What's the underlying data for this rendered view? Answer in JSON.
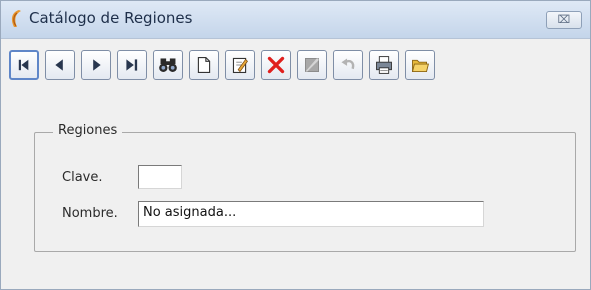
{
  "window": {
    "title": "Catálogo de Regiones",
    "close_glyph": "⌧"
  },
  "toolbar": {
    "buttons": [
      {
        "name": "first-record-button",
        "icon": "first-record-icon"
      },
      {
        "name": "previous-record-button",
        "icon": "previous-record-icon"
      },
      {
        "name": "next-record-button",
        "icon": "next-record-icon"
      },
      {
        "name": "last-record-button",
        "icon": "last-record-icon"
      },
      {
        "name": "search-button",
        "icon": "binoculars-icon"
      },
      {
        "name": "new-button",
        "icon": "new-document-icon"
      },
      {
        "name": "edit-button",
        "icon": "edit-icon"
      },
      {
        "name": "delete-button",
        "icon": "delete-icon"
      },
      {
        "name": "save-button",
        "icon": "save-icon"
      },
      {
        "name": "undo-button",
        "icon": "undo-icon"
      },
      {
        "name": "print-button",
        "icon": "printer-icon"
      },
      {
        "name": "open-button",
        "icon": "folder-icon"
      }
    ]
  },
  "form": {
    "group_title": "Regiones",
    "clave_label": "Clave.",
    "clave_value": "",
    "nombre_label": "Nombre.",
    "nombre_value": "No asignada..."
  },
  "colors": {
    "delete_red": "#e0201e",
    "nav_dark": "#28364e",
    "accent_blue": "#5f86c8"
  }
}
